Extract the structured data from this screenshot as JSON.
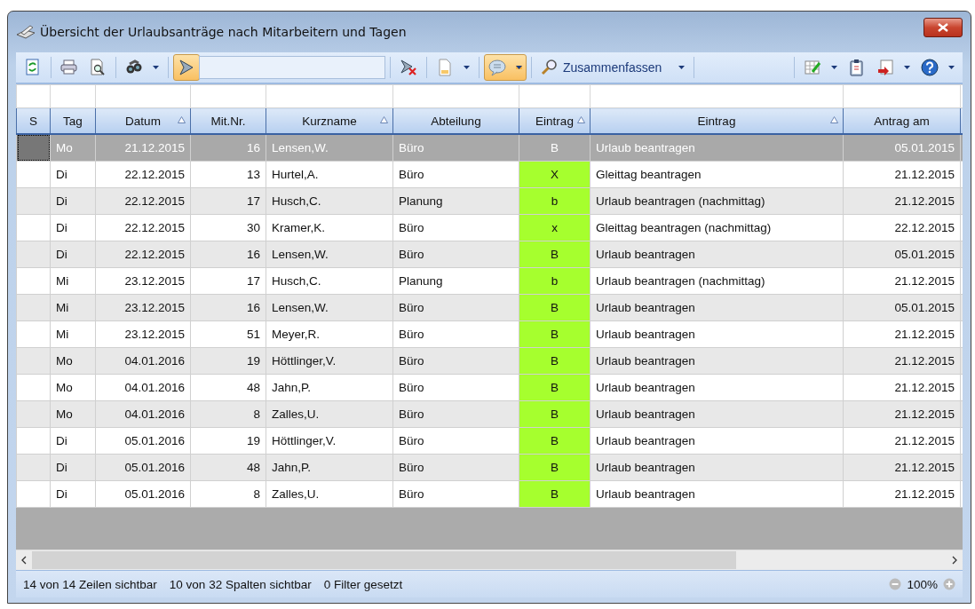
{
  "window": {
    "title": "Übersicht der Urlaubsanträge nach Mitarbeitern und Tagen"
  },
  "toolbar": {
    "items": [
      {
        "kind": "button",
        "pressed": false,
        "dropdown": false
      },
      {
        "kind": "separator"
      },
      {
        "kind": "button",
        "pressed": false,
        "dropdown": false
      },
      {
        "kind": "button",
        "pressed": false,
        "dropdown": false
      },
      {
        "kind": "separator"
      },
      {
        "kind": "button",
        "pressed": false,
        "dropdown": true
      },
      {
        "kind": "separator"
      },
      {
        "kind": "button",
        "pressed": true,
        "dropdown": false
      },
      {
        "kind": "field"
      },
      {
        "kind": "separator"
      },
      {
        "kind": "button",
        "pressed": false,
        "dropdown": false
      },
      {
        "kind": "separator"
      },
      {
        "kind": "button",
        "pressed": false,
        "dropdown": true
      },
      {
        "kind": "separator"
      },
      {
        "kind": "button",
        "pressed": true,
        "dropdown": true
      },
      {
        "kind": "separator"
      },
      {
        "kind": "label-button",
        "label": "Zusammenfassen",
        "pressed": false,
        "dropdown": true
      },
      {
        "kind": "separator"
      },
      {
        "kind": "spacer"
      },
      {
        "kind": "separator"
      },
      {
        "kind": "button",
        "pressed": false,
        "dropdown": true
      },
      {
        "kind": "button",
        "pressed": false,
        "dropdown": false
      },
      {
        "kind": "button",
        "pressed": false,
        "dropdown": true
      },
      {
        "kind": "button",
        "pressed": false,
        "dropdown": true
      }
    ]
  },
  "table": {
    "columns": [
      {
        "label": "S",
        "sorted": false
      },
      {
        "label": "Tag",
        "sorted": false
      },
      {
        "label": "Datum",
        "sorted": true
      },
      {
        "label": "Mit.Nr.",
        "sorted": false
      },
      {
        "label": "Kurzname",
        "sorted": true
      },
      {
        "label": "Abteilung",
        "sorted": false
      },
      {
        "label": "Eintrag",
        "sorted": true
      },
      {
        "label": "Eintrag",
        "sorted": true
      },
      {
        "label": "Antrag am",
        "sorted": false
      }
    ],
    "rows": [
      {
        "selected": true,
        "cells": [
          "",
          "Mo",
          "21.12.2015",
          "16",
          "Lensen,W.",
          "Büro",
          "B",
          "Urlaub beantragen",
          "05.01.2015"
        ]
      },
      {
        "selected": false,
        "cells": [
          "",
          "Di",
          "22.12.2015",
          "13",
          "Hurtel,A.",
          "Büro",
          "X",
          "Gleittag beantragen",
          "21.12.2015"
        ]
      },
      {
        "selected": false,
        "cells": [
          "",
          "Di",
          "22.12.2015",
          "17",
          "Husch,C.",
          "Planung",
          "b",
          "Urlaub beantragen (nachmittag)",
          "21.12.2015"
        ]
      },
      {
        "selected": false,
        "cells": [
          "",
          "Di",
          "22.12.2015",
          "30",
          "Kramer,K.",
          "Büro",
          "x",
          "Gleittag beantragen (nachmittag)",
          "22.12.2015"
        ]
      },
      {
        "selected": false,
        "cells": [
          "",
          "Di",
          "22.12.2015",
          "16",
          "Lensen,W.",
          "Büro",
          "B",
          "Urlaub beantragen",
          "05.01.2015"
        ]
      },
      {
        "selected": false,
        "cells": [
          "",
          "Mi",
          "23.12.2015",
          "17",
          "Husch,C.",
          "Planung",
          "b",
          "Urlaub beantragen (nachmittag)",
          "21.12.2015"
        ]
      },
      {
        "selected": false,
        "cells": [
          "",
          "Mi",
          "23.12.2015",
          "16",
          "Lensen,W.",
          "Büro",
          "B",
          "Urlaub beantragen",
          "05.01.2015"
        ]
      },
      {
        "selected": false,
        "cells": [
          "",
          "Mi",
          "23.12.2015",
          "51",
          "Meyer,R.",
          "Büro",
          "B",
          "Urlaub beantragen",
          "21.12.2015"
        ]
      },
      {
        "selected": false,
        "cells": [
          "",
          "Mo",
          "04.01.2016",
          "19",
          "Höttlinger,V.",
          "Büro",
          "B",
          "Urlaub beantragen",
          "21.12.2015"
        ]
      },
      {
        "selected": false,
        "cells": [
          "",
          "Mo",
          "04.01.2016",
          "48",
          "Jahn,P.",
          "Büro",
          "B",
          "Urlaub beantragen",
          "21.12.2015"
        ]
      },
      {
        "selected": false,
        "cells": [
          "",
          "Mo",
          "04.01.2016",
          "8",
          "Zalles,U.",
          "Büro",
          "B",
          "Urlaub beantragen",
          "21.12.2015"
        ]
      },
      {
        "selected": false,
        "cells": [
          "",
          "Di",
          "05.01.2016",
          "19",
          "Höttlinger,V.",
          "Büro",
          "B",
          "Urlaub beantragen",
          "21.12.2015"
        ]
      },
      {
        "selected": false,
        "cells": [
          "",
          "Di",
          "05.01.2016",
          "48",
          "Jahn,P.",
          "Büro",
          "B",
          "Urlaub beantragen",
          "21.12.2015"
        ]
      },
      {
        "selected": false,
        "cells": [
          "",
          "Di",
          "05.01.2016",
          "8",
          "Zalles,U.",
          "Büro",
          "B",
          "Urlaub beantragen",
          "21.12.2015"
        ]
      }
    ]
  },
  "status_bar": {
    "texts": [
      "14 von 14 Zeilen sichtbar",
      "10 von 32 Spalten sichtbar",
      "0 Filter gesetzt"
    ],
    "zoom": "100%"
  }
}
